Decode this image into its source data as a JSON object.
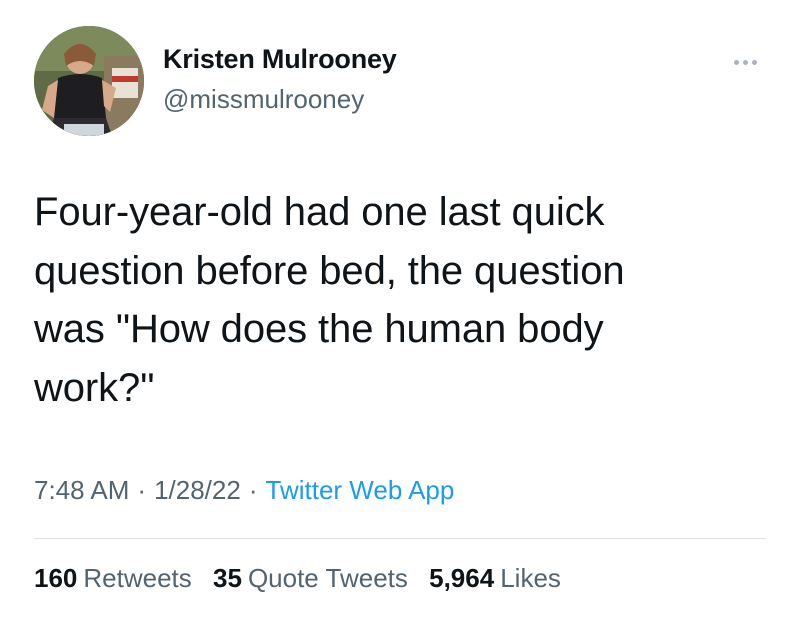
{
  "user": {
    "name": "Kristen Mulrooney",
    "handle": "@missmulrooney"
  },
  "tweet": {
    "text": "Four-year-old had one last quick\nquestion before bed, the question\nwas \"How does the human body\nwork?\""
  },
  "meta": {
    "time": "7:48 AM",
    "date": "1/28/22",
    "separator": "·",
    "source": "Twitter Web App"
  },
  "stats": {
    "retweets_count": "160",
    "retweets_label": "Retweets",
    "quotes_count": "35",
    "quotes_label": "Quote Tweets",
    "likes_count": "5,964",
    "likes_label": "Likes"
  },
  "colors": {
    "text_primary": "#0f1419",
    "text_secondary": "#536471",
    "link": "#1d9bf0",
    "divider": "#dfe3e6"
  },
  "icons": {
    "more": "more-horizontal-icon"
  }
}
